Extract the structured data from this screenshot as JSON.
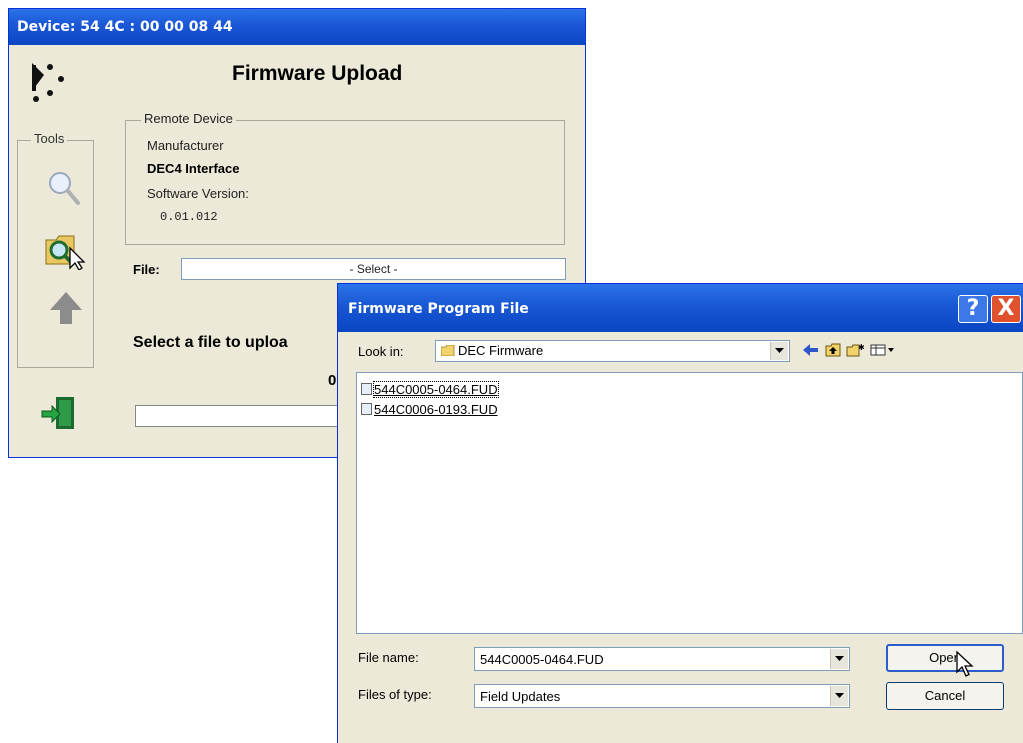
{
  "main_window": {
    "title": "Device:  54 4C : 00 00 08 44",
    "heading": "Firmware Upload",
    "tools_label": "Tools",
    "remote_device": {
      "legend": "Remote Device",
      "manufacturer_label": "Manufacturer",
      "manufacturer_value": "DEC4 Interface",
      "software_label": "Software Version:",
      "software_value": "0.01.012"
    },
    "file_label": "File:",
    "file_value": "- Select -",
    "status_message": "Select a file to uploa",
    "progress_value": "0"
  },
  "dialog": {
    "title": "Firmware Program File",
    "help_label": "?",
    "close_label": "X",
    "look_in_label": "Look in:",
    "look_in_value": "DEC Firmware",
    "files": [
      {
        "name": "544C0005-0464.FUD",
        "selected": true
      },
      {
        "name": "544C0006-0193.FUD",
        "selected": false
      }
    ],
    "file_name_label": "File name:",
    "file_name_value": "544C0005-0464.FUD",
    "files_of_type_label": "Files of type:",
    "files_of_type_value": "Field Updates",
    "open_button": "Open",
    "cancel_button": "Cancel"
  },
  "icons": {
    "toolbar": [
      "back-arrow-icon",
      "up-folder-icon",
      "new-folder-icon",
      "view-menu-icon"
    ],
    "tools": [
      "magnifier-icon",
      "folder-search-icon",
      "upload-arrow-icon",
      "exit-door-icon"
    ]
  }
}
